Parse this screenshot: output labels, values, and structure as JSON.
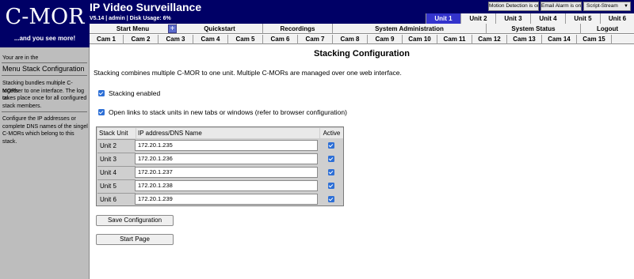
{
  "sidebar": {
    "logo": "C-MOR",
    "tagline": "...and you see more!",
    "location_label": "Your are in the",
    "menu_title": "Menu Stack Configuration",
    "help1": [
      "Stacking bundles multiple C-MORs",
      "together to one interface. The log on",
      "takes place once for all configured",
      "stack members."
    ],
    "help2": [
      "Configure the IP addresses or",
      "complete DNS names of the singel",
      "C-MORs which belong to this stack."
    ]
  },
  "header": {
    "title": "IP Video Surveillance",
    "status": "V5.14 | admin | Disk Usage: 6%",
    "motion_button": "Motion Detection is on",
    "email_button": "Email Alarm is on",
    "stream_select": "Script-Stream"
  },
  "units": [
    "Unit 1",
    "Unit 2",
    "Unit 3",
    "Unit 4",
    "Unit 5",
    "Unit 6"
  ],
  "active_unit": "Unit 1",
  "menu": {
    "start": "Start Menu",
    "quickstart": "Quickstart",
    "recordings": "Recordings",
    "sysadmin": "System Administration",
    "status": "System Status",
    "logout": "Logout"
  },
  "cams": [
    "Cam 1",
    "Cam 2",
    "Cam 3",
    "Cam 4",
    "Cam 5",
    "Cam 6",
    "Cam 7",
    "Cam 8",
    "Cam 9",
    "Cam 10",
    "Cam 11",
    "Cam 12",
    "Cam 13",
    "Cam 14",
    "Cam 15"
  ],
  "content": {
    "title": "Stacking Configuration",
    "intro": "Stacking combines multiple C-MOR to one unit. Multiple C-MORs are managed over one web interface.",
    "stacking_enabled": "Stacking enabled",
    "open_links": "Open links to stack units in new tabs or windows (refer to browser configuration)"
  },
  "table": {
    "headers": [
      "Stack Unit",
      "IP address/DNS Name",
      "Active"
    ],
    "rows": [
      {
        "unit": "Unit 2",
        "ip": "172.20.1.235",
        "active": true
      },
      {
        "unit": "Unit 3",
        "ip": "172.20.1.236",
        "active": true
      },
      {
        "unit": "Unit 4",
        "ip": "172.20.1.237",
        "active": true
      },
      {
        "unit": "Unit 5",
        "ip": "172.20.1.238",
        "active": true
      },
      {
        "unit": "Unit 6",
        "ip": "172.20.1.239",
        "active": true
      }
    ]
  },
  "buttons": {
    "save": "Save Configuration",
    "start_page": "Start Page"
  }
}
